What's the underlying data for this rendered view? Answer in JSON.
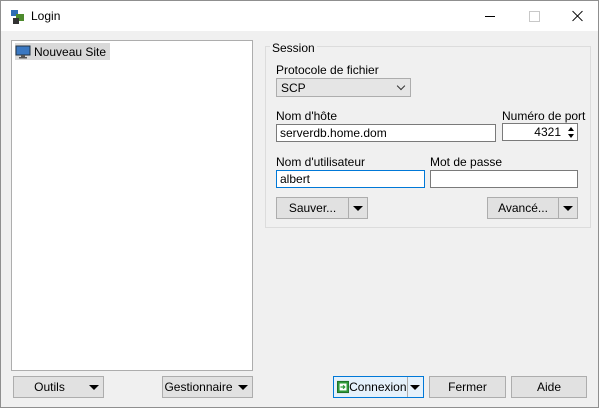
{
  "window": {
    "title": "Login",
    "accent_color": "#0078d7",
    "controls": {
      "minimize": "minimize-icon",
      "maximize": "maximize-icon",
      "close": "close-icon"
    }
  },
  "site_tree": {
    "items": [
      {
        "label": "Nouveau Site",
        "icon": "monitor-icon",
        "selected": true
      }
    ]
  },
  "session": {
    "legend": "Session",
    "protocol_label": "Protocole de fichier",
    "protocol_value": "SCP",
    "host_label": "Nom d'hôte",
    "host_value": "serverdb.home.dom",
    "port_label": "Numéro de port",
    "port_value": "4321",
    "user_label": "Nom d'utilisateur",
    "user_value": "albert",
    "password_label": "Mot de passe",
    "password_value": "",
    "save_label": "Sauver...",
    "advanced_label": "Avancé..."
  },
  "footer": {
    "tools_label": "Outils",
    "manager_label": "Gestionnaire",
    "connect_label": "Connexion",
    "close_label": "Fermer",
    "help_label": "Aide"
  }
}
